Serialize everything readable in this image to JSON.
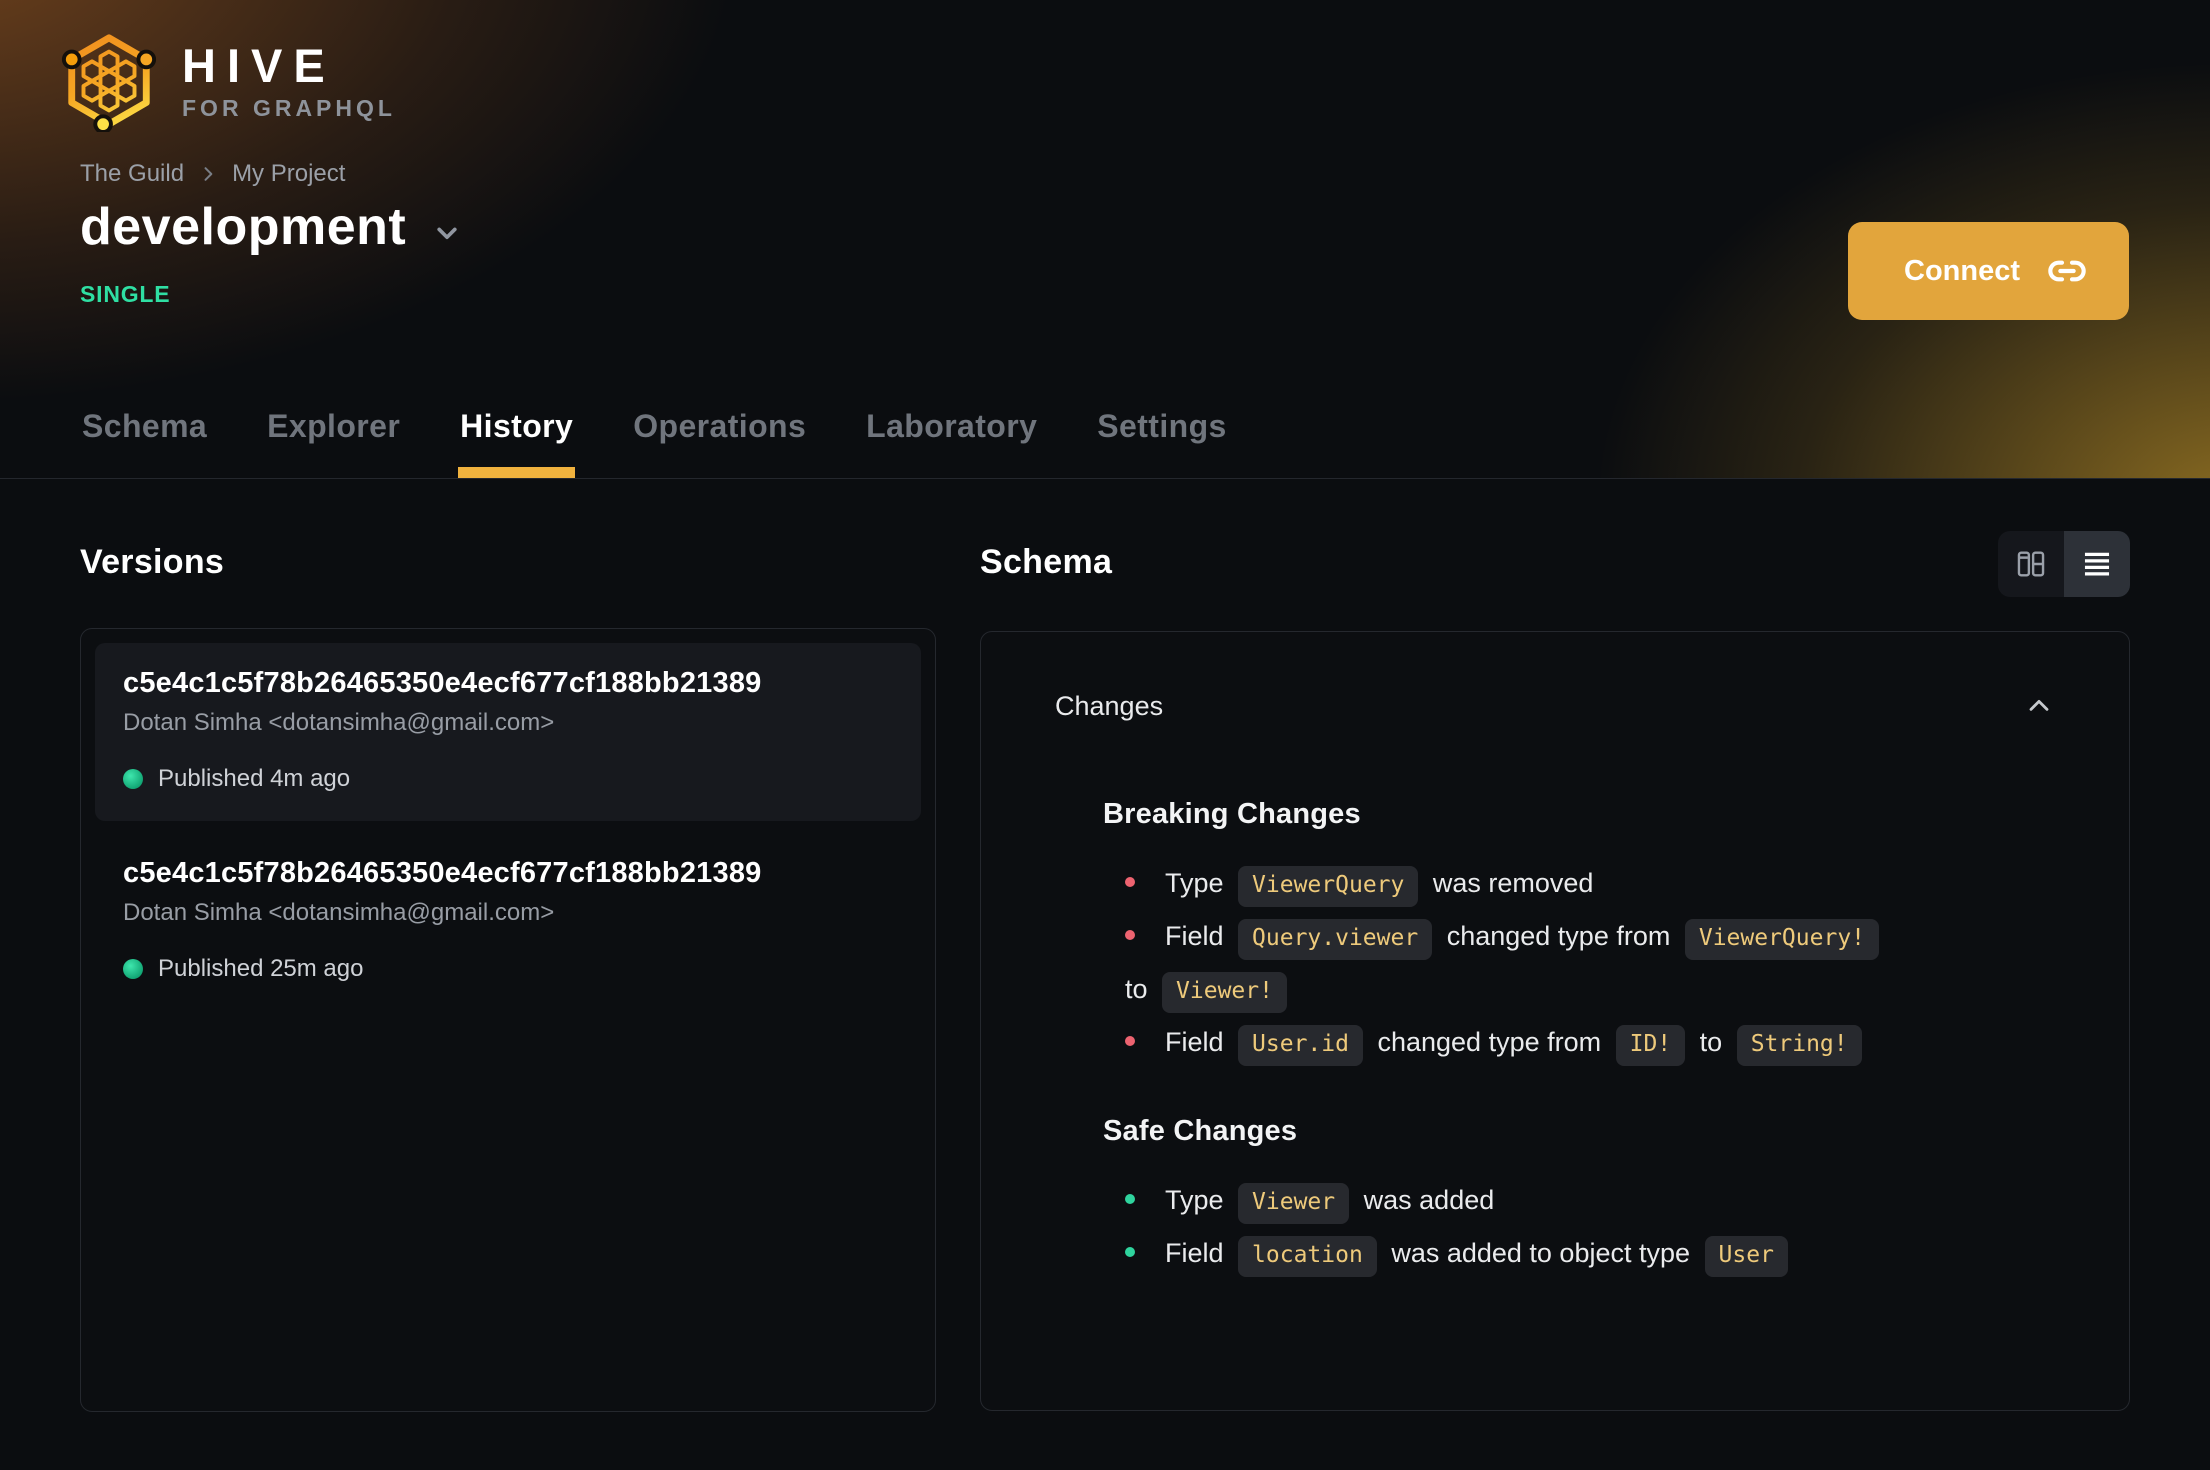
{
  "brand": {
    "name": "HIVE",
    "tagline": "FOR GRAPHQL"
  },
  "breadcrumb": {
    "items": [
      "The Guild",
      "My Project"
    ]
  },
  "target": {
    "name": "development",
    "badge": "SINGLE"
  },
  "connect": {
    "label": "Connect"
  },
  "tabs": {
    "active": "History",
    "items": [
      {
        "label": "Schema"
      },
      {
        "label": "Explorer"
      },
      {
        "label": "History"
      },
      {
        "label": "Operations"
      },
      {
        "label": "Laboratory"
      },
      {
        "label": "Settings"
      }
    ]
  },
  "versions": {
    "heading": "Versions",
    "items": [
      {
        "hash": "c5e4c1c5f78b26465350e4ecf677cf188bb21389",
        "author": "Dotan Simha <dotansimha@gmail.com>",
        "status": "Published 4m ago",
        "selected": true
      },
      {
        "hash": "c5e4c1c5f78b26465350e4ecf677cf188bb21389",
        "author": "Dotan Simha <dotansimha@gmail.com>",
        "status": "Published 25m ago",
        "selected": false
      }
    ]
  },
  "schema": {
    "heading": "Schema"
  },
  "changes": {
    "title": "Changes",
    "collapsed": false,
    "groups": [
      {
        "kind": "breaking",
        "name": "Breaking Changes",
        "bullet_color": "#ed6370",
        "items": [
          [
            {
              "text": "Type "
            },
            {
              "code": "ViewerQuery"
            },
            {
              "text": " was removed"
            }
          ],
          [
            {
              "text": "Field "
            },
            {
              "code": "Query.viewer"
            },
            {
              "text": " changed type from "
            },
            {
              "code": "ViewerQuery!"
            },
            {
              "break": true
            },
            {
              "text": "to "
            },
            {
              "code": "Viewer!"
            }
          ],
          [
            {
              "text": "Field "
            },
            {
              "code": "User.id"
            },
            {
              "text": " changed type from "
            },
            {
              "code": "ID!"
            },
            {
              "text": " to "
            },
            {
              "code": "String!"
            }
          ]
        ]
      },
      {
        "kind": "safe",
        "name": "Safe Changes",
        "bullet_color": "#2fd49e",
        "items": [
          [
            {
              "text": "Type "
            },
            {
              "code": "Viewer"
            },
            {
              "text": " was added"
            }
          ],
          [
            {
              "text": "Field "
            },
            {
              "code": "location"
            },
            {
              "text": " was added to object type "
            },
            {
              "code": "User"
            }
          ]
        ]
      }
    ]
  },
  "icons": {
    "hive-logo": "hexagon honeycomb",
    "chevron-right-icon": "›",
    "chevron-down-icon": "⌄",
    "chevron-up-icon": "⌃",
    "link-icon": "chain link",
    "columns-view-icon": "two columns layout",
    "list-view-icon": "four horizontal lines",
    "status-dot-icon": "green circle",
    "bullet-dot-icon": "colored circle"
  },
  "colors": {
    "accent": "#f0b23e",
    "connect_button": "#e2a53c",
    "single_badge": "#2fdfa3",
    "breaking_bullet": "#ed6370",
    "safe_bullet": "#2fd49e",
    "chip_bg": "#27292e",
    "chip_text": "#eeca7b",
    "published_dot": "#10b981",
    "background": "#0b0d10"
  }
}
